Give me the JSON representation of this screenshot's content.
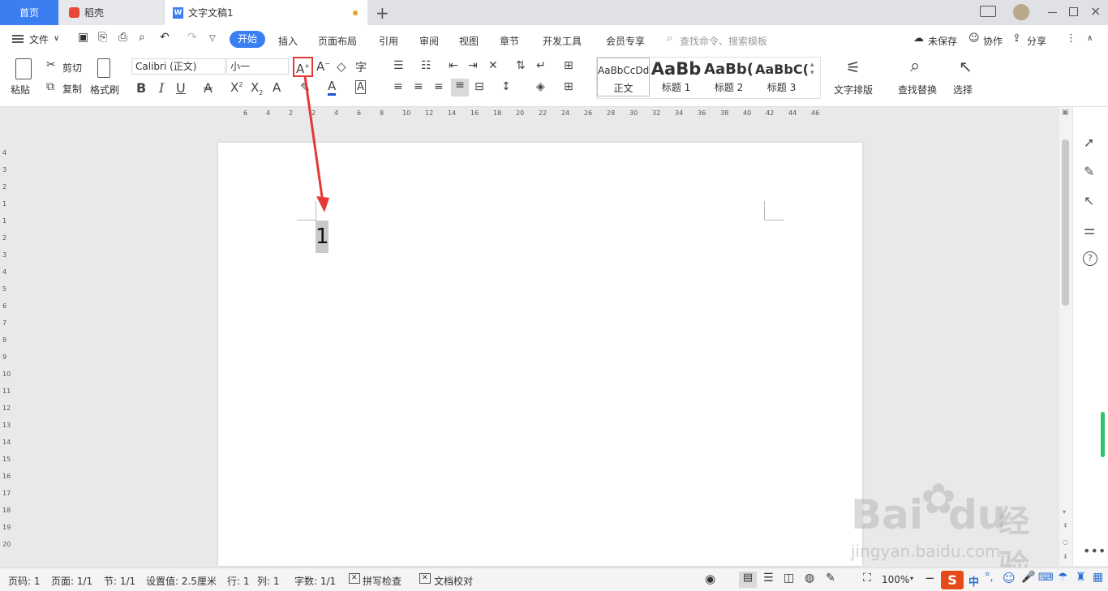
{
  "tabs": {
    "home": "首页",
    "daoke": "稻壳",
    "doc": "文字文稿1"
  },
  "menu": {
    "file": "文件",
    "items": [
      "开始",
      "插入",
      "页面布局",
      "引用",
      "审阅",
      "视图",
      "章节",
      "开发工具",
      "会员专享"
    ],
    "search_placeholder": "查找命令、搜索模板",
    "unsaved": "未保存",
    "collab": "协作",
    "share": "分享"
  },
  "ribbon": {
    "paste": "粘贴",
    "cut": "剪切",
    "copy": "复制",
    "format_painter": "格式刷",
    "font_name": "Calibri (正文)",
    "font_size": "小一",
    "styles": [
      {
        "preview": "AaBbCcDd",
        "label": "正文"
      },
      {
        "preview": "AaBb",
        "label": "标题 1"
      },
      {
        "preview": "AaBb(",
        "label": "标题 2"
      },
      {
        "preview": "AaBbC(",
        "label": "标题 3"
      }
    ],
    "text_layout": "文字排版",
    "find_replace": "查找替换",
    "select": "选择"
  },
  "ruler_top": [
    "6",
    "4",
    "2",
    "2",
    "4",
    "6",
    "8",
    "10",
    "12",
    "14",
    "16",
    "18",
    "20",
    "22",
    "24",
    "26",
    "28",
    "30",
    "32",
    "34",
    "36",
    "38",
    "40",
    "42",
    "44",
    "46"
  ],
  "ruler_left": [
    "4",
    "3",
    "2",
    "1",
    "1",
    "2",
    "3",
    "4",
    "5",
    "6",
    "7",
    "8",
    "9",
    "10",
    "11",
    "12",
    "13",
    "14",
    "15",
    "16",
    "17",
    "18",
    "19",
    "20"
  ],
  "document": {
    "text": "1"
  },
  "status": {
    "page_num": "页码: 1",
    "pages": "页面: 1/1",
    "section": "节: 1/1",
    "setting": "设置值: 2.5厘米",
    "row": "行: 1",
    "col": "列: 1",
    "word_count": "字数: 1/1",
    "spell_check": "拼写检查",
    "doc_proof": "文档校对",
    "zoom": "100%"
  },
  "ime": {
    "lang": "中"
  },
  "watermark": {
    "brand": "Bai",
    "brand2": "du",
    "cn": "经验",
    "url": "jingyan.baidu.com"
  },
  "colors": {
    "accent": "#3a7ef2",
    "highlight_box": "#e53935",
    "arrow": "#e53935"
  }
}
